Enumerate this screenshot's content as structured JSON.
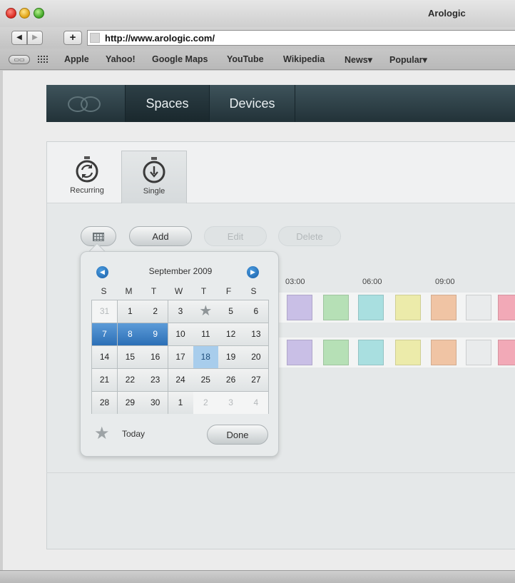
{
  "window": {
    "title": "Arologic"
  },
  "browser": {
    "url": "http://www.arologic.com/",
    "back_icon": "◀",
    "forward_icon": "▶",
    "add_icon": "+",
    "reader_icon": "reader-icon",
    "bookmarks": [
      "Apple",
      "Yahoo!",
      "Google Maps",
      "YouTube",
      "Wikipedia",
      "News▾",
      "Popular▾"
    ]
  },
  "app_nav": {
    "tabs": [
      "Spaces",
      "Devices"
    ],
    "active": "Spaces"
  },
  "mode_tabs": {
    "recurring": "Recurring",
    "single": "Single",
    "active": "Single"
  },
  "actions": {
    "add": "Add",
    "edit": "Edit",
    "delete": "Delete"
  },
  "schedule": {
    "times": [
      "03:00",
      "06:00",
      "09:00"
    ],
    "slot_colors": [
      "#c9bfe6",
      "#b6e0b6",
      "#a9dfe0",
      "#ecebaa",
      "#f0c4a4",
      "#e9ebec",
      "#f2a9b7"
    ]
  },
  "calendar": {
    "month": "September 2009",
    "weekdays": [
      "S",
      "M",
      "T",
      "W",
      "T",
      "F",
      "S"
    ],
    "weeks": [
      [
        "31",
        "1",
        "2",
        "3",
        "4",
        "5",
        "6"
      ],
      [
        "7",
        "8",
        "9",
        "10",
        "11",
        "12",
        "13"
      ],
      [
        "14",
        "15",
        "16",
        "17",
        "18",
        "19",
        "20"
      ],
      [
        "21",
        "22",
        "23",
        "24",
        "25",
        "26",
        "27"
      ],
      [
        "28",
        "29",
        "30",
        "1",
        "2",
        "3",
        "4"
      ]
    ],
    "range_days": [
      "7",
      "8",
      "9"
    ],
    "selected_day": "18",
    "today_day": "4",
    "today_label": "Today",
    "done_label": "Done"
  },
  "colors": {
    "nav_bg": "#2c3e45",
    "accent_blue": "#2c6fb6"
  }
}
